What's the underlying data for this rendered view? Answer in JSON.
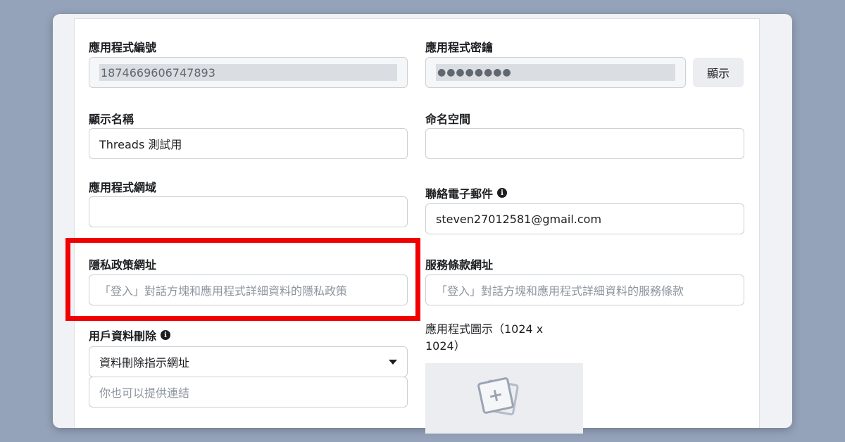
{
  "app_id": {
    "label": "應用程式編號",
    "value": "1874669606747893"
  },
  "app_secret": {
    "label": "應用程式密鑰",
    "value": "●●●●●●●●",
    "show_label": "顯示"
  },
  "display_name": {
    "label": "顯示名稱",
    "value": "Threads 測試用"
  },
  "namespace": {
    "label": "命名空間",
    "value": ""
  },
  "app_domains": {
    "label": "應用程式網域",
    "value": ""
  },
  "contact_email": {
    "label": "聯絡電子郵件",
    "value": "steven27012581@gmail.com"
  },
  "privacy_policy": {
    "label": "隱私政策網址",
    "placeholder": "「登入」對話方塊和應用程式詳細資料的隱私政策"
  },
  "terms_of_service": {
    "label": "服務條款網址",
    "placeholder": "「登入」對話方塊和應用程式詳細資料的服務條款"
  },
  "data_deletion": {
    "label": "用戶資料刪除",
    "select_value": "資料刪除指示網址",
    "link_placeholder": "你也可以提供連結"
  },
  "app_icon": {
    "label": "應用程式圖示（1024 x 1024）"
  },
  "colors": {
    "highlight": "#f00000",
    "background": "#95a3ba"
  },
  "icons": {
    "info": "info-icon",
    "dropdown": "caret-down-icon",
    "add_image": "add-image-icon"
  }
}
